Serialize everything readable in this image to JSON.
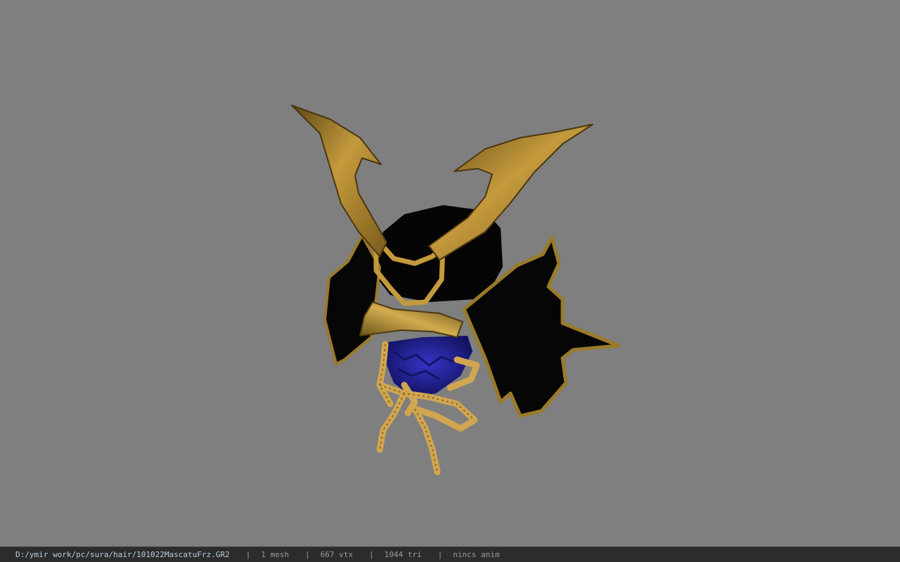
{
  "viewer": {
    "background_color": "#7f7f7f",
    "model_name": "101022MascatuFrz",
    "materials": {
      "gold": "#c49a3c",
      "black": "#050505",
      "mask_blue": "#2a2aa8",
      "rope": "#d1a650"
    }
  },
  "status": {
    "file_path": "D:/ymir work/pc/sura/hair/101022MascatuFrz.GR2",
    "separator": "|",
    "mesh_count": "1 mesh",
    "vertex_count": "667 vtx",
    "triangle_count": "1044 tri",
    "anim_label": "nincs anim"
  }
}
